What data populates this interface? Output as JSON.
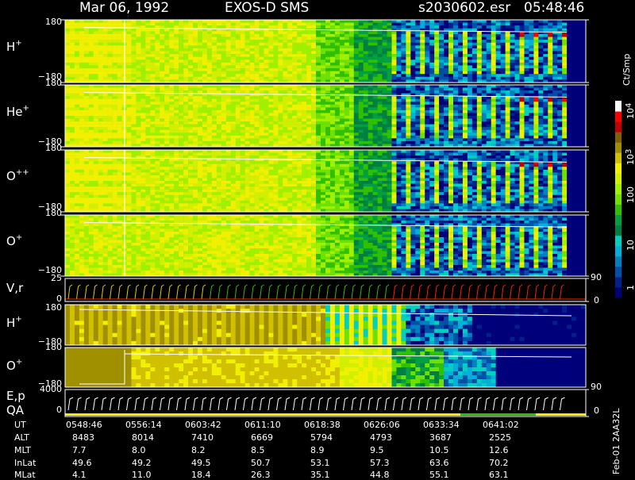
{
  "header": {
    "date": "Mar 06, 1992",
    "instrument": "EXOS-D SMS",
    "file": "s2030602.esr",
    "time": "05:48:46"
  },
  "panels": [
    {
      "label": "H",
      "sup": "+",
      "ytop": "180",
      "ybot": "−180"
    },
    {
      "label": "He",
      "sup": "+",
      "ytop": "180",
      "ybot": "−180"
    },
    {
      "label": "O",
      "sup": "++",
      "ytop": "180",
      "ybot": "−180"
    },
    {
      "label": "O",
      "sup": "+",
      "ytop": "180",
      "ybot": "−180"
    },
    {
      "label": "V,r",
      "sup": "",
      "ytop": "25",
      "ybot": "0",
      "rtop": "90",
      "rbot": "0"
    },
    {
      "label": "H",
      "sup": "+",
      "ytop": "180",
      "ybot": "−180"
    },
    {
      "label": "O",
      "sup": "+",
      "ytop": "180",
      "ybot": "−180"
    },
    {
      "label": "E,p",
      "sup": "",
      "label2": "QA",
      "ytop": "4000",
      "ybot": "0",
      "rtop": "90",
      "rbot": "0"
    }
  ],
  "colorbar": {
    "unit": "Ct/Smp",
    "labels": [
      "10",
      "10",
      "100",
      "10",
      "1"
    ],
    "sups": [
      "4",
      "3",
      "",
      "",
      ""
    ]
  },
  "colors": {
    "scale": [
      "#00007a",
      "#00208c",
      "#0050a8",
      "#0080c0",
      "#00b0d8",
      "#00d0c0",
      "#008040",
      "#00a040",
      "#30c000",
      "#70e000",
      "#a0f000",
      "#d0f000",
      "#f0f000",
      "#d0c000",
      "#a09000",
      "#806000",
      "#c00000",
      "#ff0000",
      "#ffffff"
    ]
  },
  "footer": {
    "row_labels": [
      "UT",
      "ALT",
      "MLT",
      "InLat",
      "MLat"
    ],
    "columns": [
      [
        "0548:46",
        "8483",
        "7.7",
        "49.6",
        "4.1"
      ],
      [
        "0556:14",
        "8014",
        "8.0",
        "49.2",
        "11.0"
      ],
      [
        "0603:42",
        "7410",
        "8.2",
        "49.5",
        "18.4"
      ],
      [
        "0611:10",
        "6669",
        "8.5",
        "50.7",
        "26.3"
      ],
      [
        "0618:38",
        "5794",
        "8.9",
        "53.1",
        "35.1"
      ],
      [
        "0626:06",
        "4793",
        "9.5",
        "57.3",
        "44.8"
      ],
      [
        "0633:34",
        "3687",
        "10.5",
        "63.6",
        "55.1"
      ],
      [
        "0641:02",
        "2525",
        "12.6",
        "70.2",
        "63.1"
      ]
    ],
    "side_note": "Feb-01 2AA32L"
  },
  "chart_data": {
    "type": "heatmap",
    "title": "Mar 06, 1992   EXOS-D SMS",
    "x": [
      "0548:46",
      "0556:14",
      "0603:42",
      "0611:10",
      "0618:38",
      "0626:06",
      "0633:34",
      "0641:02"
    ],
    "xlabel": "UT",
    "colorbar_unit": "Ct/Smp",
    "colorbar_ticks": [
      "1",
      "10",
      "100",
      "10^3",
      "10^4"
    ],
    "series": [
      {
        "name": "H+",
        "ylim": [
          -180,
          180
        ]
      },
      {
        "name": "He+",
        "ylim": [
          -180,
          180
        ]
      },
      {
        "name": "O++",
        "ylim": [
          -180,
          180
        ]
      },
      {
        "name": "O+",
        "ylim": [
          -180,
          180
        ]
      },
      {
        "name": "V,r",
        "ylim": [
          0,
          25
        ],
        "right_ylim": [
          0,
          90
        ]
      },
      {
        "name": "H+",
        "ylim": [
          -180,
          180
        ]
      },
      {
        "name": "O+",
        "ylim": [
          -180,
          180
        ]
      },
      {
        "name": "E,p QA",
        "ylim": [
          0,
          4000
        ],
        "right_ylim": [
          0,
          90
        ]
      }
    ]
  }
}
